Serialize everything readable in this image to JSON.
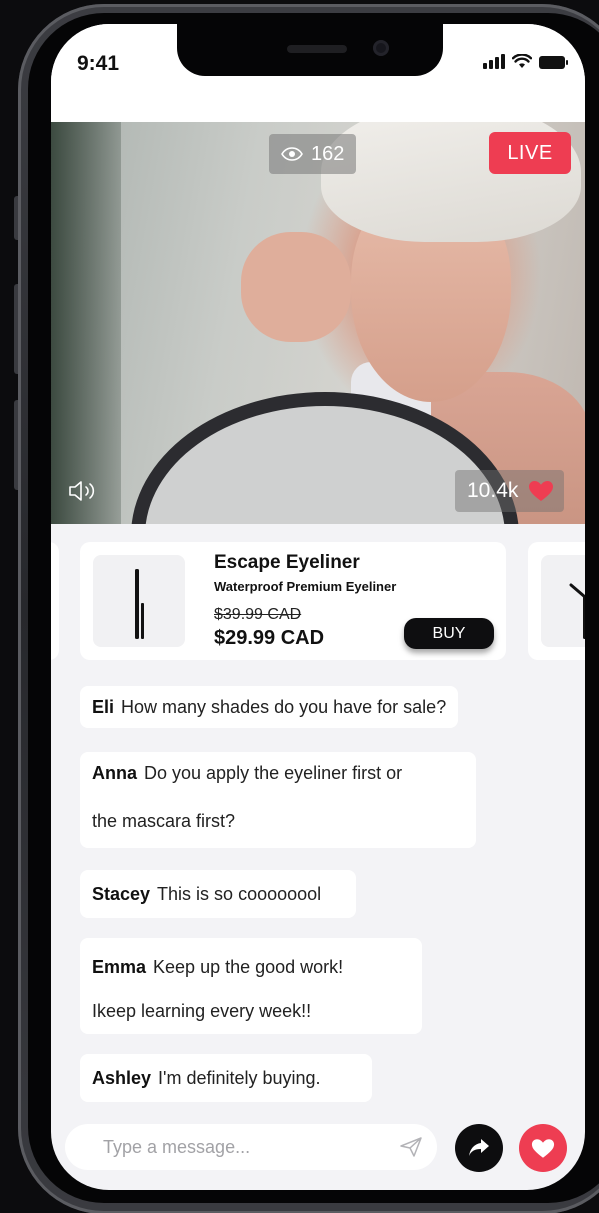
{
  "status_bar": {
    "time": "9:41"
  },
  "video": {
    "viewer_count": "162",
    "live_label": "LIVE",
    "like_count": "10.4k"
  },
  "product": {
    "name": "Escape Eyeliner",
    "subtitle": "Waterproof Premium Eyeliner",
    "original_price": "$39.99 CAD",
    "sale_price": "$29.99 CAD",
    "buy_label": "BUY"
  },
  "chat": {
    "messages": [
      {
        "user": "Eli",
        "lines": [
          "How many shades do you have for sale?"
        ]
      },
      {
        "user": "Anna",
        "lines": [
          "Do you apply the eyeliner first or",
          "the mascara first?"
        ]
      },
      {
        "user": "Stacey",
        "lines": [
          "This is so coooooool"
        ]
      },
      {
        "user": "Emma",
        "lines": [
          "Keep up the good work!",
          "Ikeep learning every week!!"
        ]
      },
      {
        "user": "Ashley",
        "lines": [
          "I'm definitely buying."
        ]
      }
    ]
  },
  "composer": {
    "placeholder": "Type a message..."
  },
  "colors": {
    "accent": "#ee3d52",
    "dark": "#0e0e10",
    "background": "#f3f3f6"
  },
  "icons": [
    "eye-icon",
    "volume-icon",
    "heart-icon",
    "send-icon",
    "share-arrow-icon",
    "signal-icon",
    "wifi-icon",
    "battery-icon"
  ]
}
